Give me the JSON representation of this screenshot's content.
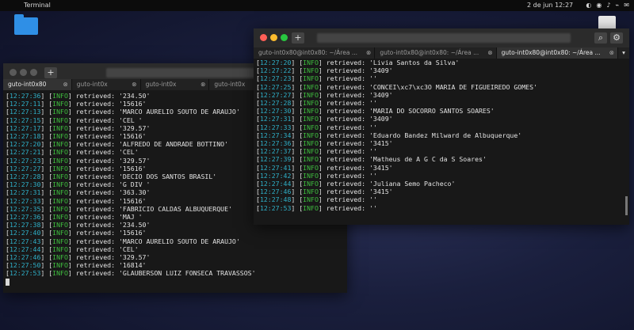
{
  "topbar": {
    "apple_icon": "",
    "app_name": "Terminal",
    "clock": "2 de jun  12:27",
    "tray": [
      "◐",
      "◉",
      "♪",
      "⌁",
      "✉"
    ]
  },
  "desktop": {
    "folder_icon": "folder-icon",
    "trash_icon": "trash-icon"
  },
  "left_window": {
    "tabs": [
      "guto-int0x80",
      "guto-int0x",
      "guto-int0x",
      "guto-int0x",
      "guto-int0x"
    ],
    "lines": [
      {
        "ts": "12:27:36",
        "lvl": "INFO",
        "msg": "retrieved: '234.50'"
      },
      {
        "ts": "12:27:11",
        "lvl": "INFO",
        "msg": "retrieved: '15616'"
      },
      {
        "ts": "12:27:13",
        "lvl": "INFO",
        "msg": "retrieved: 'MARCO AURELIO SOUTO DE ARAUJO'"
      },
      {
        "ts": "12:27:15",
        "lvl": "INFO",
        "msg": "retrieved: 'CEL '"
      },
      {
        "ts": "12:27:17",
        "lvl": "INFO",
        "msg": "retrieved: '329.57'"
      },
      {
        "ts": "12:27:18",
        "lvl": "INFO",
        "msg": "retrieved: '15616'"
      },
      {
        "ts": "12:27:20",
        "lvl": "INFO",
        "msg": "retrieved: 'ALFREDO DE ANDRADE BOTTINO'"
      },
      {
        "ts": "12:27:21",
        "lvl": "INFO",
        "msg": "retrieved: 'CEL'"
      },
      {
        "ts": "12:27:23",
        "lvl": "INFO",
        "msg": "retrieved: '329.57'"
      },
      {
        "ts": "12:27:27",
        "lvl": "INFO",
        "msg": "retrieved: '15616'"
      },
      {
        "ts": "12:27:28",
        "lvl": "INFO",
        "msg": "retrieved: 'DECIO DOS SANTOS BRASIL'"
      },
      {
        "ts": "12:27:30",
        "lvl": "INFO",
        "msg": "retrieved: 'G DIV '"
      },
      {
        "ts": "12:27:31",
        "lvl": "INFO",
        "msg": "retrieved: '363.30'"
      },
      {
        "ts": "12:27:33",
        "lvl": "INFO",
        "msg": "retrieved: '15616'"
      },
      {
        "ts": "12:27:35",
        "lvl": "INFO",
        "msg": "retrieved: 'FABRICIO CALDAS ALBUQUERQUE'"
      },
      {
        "ts": "12:27:36",
        "lvl": "INFO",
        "msg": "retrieved: 'MAJ '"
      },
      {
        "ts": "12:27:38",
        "lvl": "INFO",
        "msg": "retrieved: '234.50'"
      },
      {
        "ts": "12:27:40",
        "lvl": "INFO",
        "msg": "retrieved: '15616'"
      },
      {
        "ts": "12:27:43",
        "lvl": "INFO",
        "msg": "retrieved: 'MARCO AURELIO SOUTO DE ARAUJO'"
      },
      {
        "ts": "12:27:44",
        "lvl": "INFO",
        "msg": "retrieved: 'CEL'"
      },
      {
        "ts": "12:27:46",
        "lvl": "INFO",
        "msg": "retrieved: '329.57'"
      },
      {
        "ts": "12:27:50",
        "lvl": "INFO",
        "msg": "retrieved: '16814'"
      },
      {
        "ts": "12:27:53",
        "lvl": "INFO",
        "msg": "retrieved: 'GLAUBERSON LUIZ FONSECA TRAVASSOS'"
      }
    ]
  },
  "right_window": {
    "tabs": [
      "guto-int0x80@int0x80: ~/Área ...",
      "guto-int0x80@int0x80: ~/Área ...",
      "guto-int0x80@int0x80: ~/Área ..."
    ],
    "lines": [
      {
        "ts": "12:27:20",
        "lvl": "INFO",
        "msg": "retrieved: 'Livia Santos da Silva'"
      },
      {
        "ts": "12:27:22",
        "lvl": "INFO",
        "msg": "retrieved: '3409'"
      },
      {
        "ts": "12:27:23",
        "lvl": "INFO",
        "msg": "retrieved: ''"
      },
      {
        "ts": "12:27:25",
        "lvl": "INFO",
        "msg": "retrieved: 'CONCEI\\xc7\\xc3O MARIA DE FIGUEIREDO GOMES'"
      },
      {
        "ts": "12:27:27",
        "lvl": "INFO",
        "msg": "retrieved: '3409'"
      },
      {
        "ts": "12:27:28",
        "lvl": "INFO",
        "msg": "retrieved: ''"
      },
      {
        "ts": "12:27:30",
        "lvl": "INFO",
        "msg": "retrieved: 'MARIA DO SOCORRO SANTOS SOARES'"
      },
      {
        "ts": "12:27:31",
        "lvl": "INFO",
        "msg": "retrieved: '3409'"
      },
      {
        "ts": "12:27:33",
        "lvl": "INFO",
        "msg": "retrieved: ''"
      },
      {
        "ts": "12:27:34",
        "lvl": "INFO",
        "msg": "retrieved: 'Eduardo Bandez Milward de Albuquerque'"
      },
      {
        "ts": "12:27:36",
        "lvl": "INFO",
        "msg": "retrieved: '3415'"
      },
      {
        "ts": "12:27:37",
        "lvl": "INFO",
        "msg": "retrieved: ''"
      },
      {
        "ts": "12:27:39",
        "lvl": "INFO",
        "msg": "retrieved: 'Matheus de A G C da S Soares'"
      },
      {
        "ts": "12:27:41",
        "lvl": "INFO",
        "msg": "retrieved: '3415'"
      },
      {
        "ts": "12:27:42",
        "lvl": "INFO",
        "msg": "retrieved: ''"
      },
      {
        "ts": "12:27:44",
        "lvl": "INFO",
        "msg": "retrieved: 'Juliana Semo Pacheco'"
      },
      {
        "ts": "12:27:46",
        "lvl": "INFO",
        "msg": "retrieved: '3415'"
      },
      {
        "ts": "12:27:48",
        "lvl": "INFO",
        "msg": "retrieved: ''"
      },
      {
        "ts": "12:27:53",
        "lvl": "INFO",
        "msg": "retrieved: ''"
      }
    ]
  }
}
